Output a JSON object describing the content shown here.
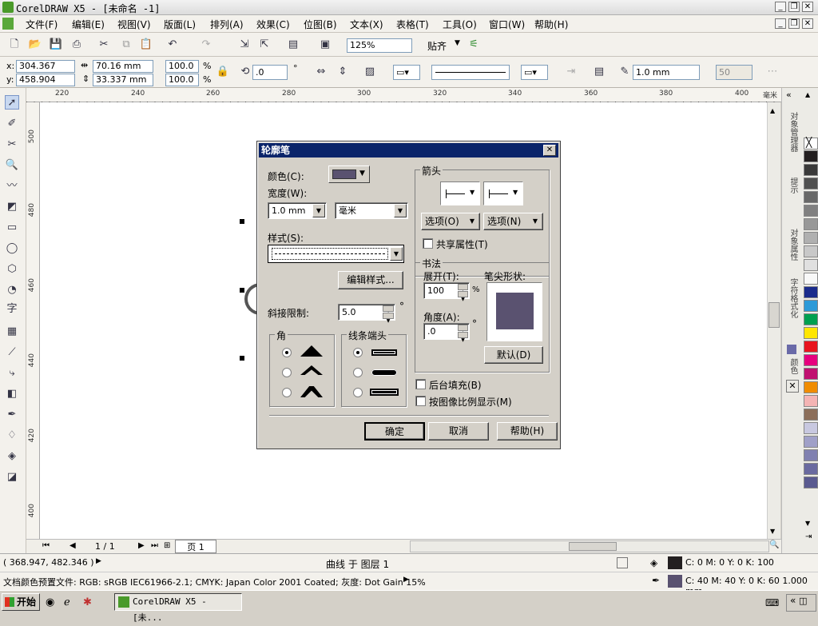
{
  "window": {
    "title": "CorelDRAW X5 - [未命名 -1]"
  },
  "menu": [
    "文件(F)",
    "编辑(E)",
    "视图(V)",
    "版面(L)",
    "排列(A)",
    "效果(C)",
    "位图(B)",
    "文本(X)",
    "表格(T)",
    "工具(O)",
    "窗口(W)",
    "帮助(H)"
  ],
  "toolbar": {
    "zoom": "125%",
    "snap": "贴齐"
  },
  "props": {
    "x_label": "x:",
    "x": "304.367 mm",
    "y_label": "y:",
    "y": "458.904 mm",
    "w": "70.16 mm",
    "h": "33.337 mm",
    "sx": "100.0",
    "sy": "100.0",
    "pct": "%",
    "angle": ".0",
    "deg": "°",
    "outline_width": "1.0 mm",
    "miter": "50"
  },
  "ruler": {
    "h": [
      "220",
      "240",
      "260",
      "280",
      "300",
      "320",
      "340",
      "360",
      "380",
      "400",
      "毫米"
    ],
    "v": [
      "500",
      "480",
      "460",
      "440",
      "420",
      "400"
    ]
  },
  "page_nav": {
    "current": "1 / 1",
    "tab": "页 1"
  },
  "status": {
    "coords": "( 368.947, 482.346 )",
    "layer": "曲线 于 图层 1",
    "fill": "C: 0 M: 0 Y: 0 K: 100",
    "outline": "C: 40 M: 40 Y: 0 K: 60  1.000 mm",
    "profile": "文档颜色预置文件: RGB: sRGB IEC61966-2.1; CMYK: Japan Color 2001 Coated; 灰度: Dot Gain 15%"
  },
  "taskbar": {
    "start": "开始",
    "task": "CorelDRAW X5 - [未..."
  },
  "docker_tabs": [
    "对象管理器",
    "提示",
    "对象属性",
    "字符格式化",
    "颜色"
  ],
  "palette": [
    "#ffffff",
    "#231f20",
    "#3a3a3a",
    "#505050",
    "#686868",
    "#808080",
    "#989898",
    "#b0b0b0",
    "#c8c8c8",
    "#e0e0e0",
    "#f8f8f8",
    "#1a2b8c",
    "#2c9ad8",
    "#00a050",
    "#ffe600",
    "#e8141e",
    "#e6007e",
    "#c01070",
    "#f08c00",
    "#f4b4b4",
    "#8c6e5a",
    "#c8c8e0",
    "#a0a0c8",
    "#8080b0",
    "#6a6aa0",
    "#5a5a90"
  ],
  "dialog": {
    "title": "轮廓笔",
    "color_label": "颜色(C):",
    "color": "#5a5270",
    "width_label": "宽度(W):",
    "width": "1.0 mm",
    "unit": "毫米",
    "style_label": "样式(S):",
    "edit_style": "编辑样式...",
    "miter_label": "斜接限制:",
    "miter": "5.0",
    "miter_unit": "°",
    "corners_label": "角",
    "caps_label": "线条端头",
    "arrows_label": "箭头",
    "options1": "选项(O)",
    "options2": "选项(N)",
    "share": "共享属性(T)",
    "calli_label": "书法",
    "stretch_label": "展开(T):",
    "stretch": "100",
    "stretch_unit": "%",
    "nib_label": "笔尖形状:",
    "angle_label": "角度(A):",
    "angle": ".0",
    "angle_unit": "°",
    "default": "默认(D)",
    "behind_fill": "后台填充(B)",
    "scale": "按图像比例显示(M)",
    "ok": "确定",
    "cancel": "取消",
    "help": "帮助(H)"
  }
}
